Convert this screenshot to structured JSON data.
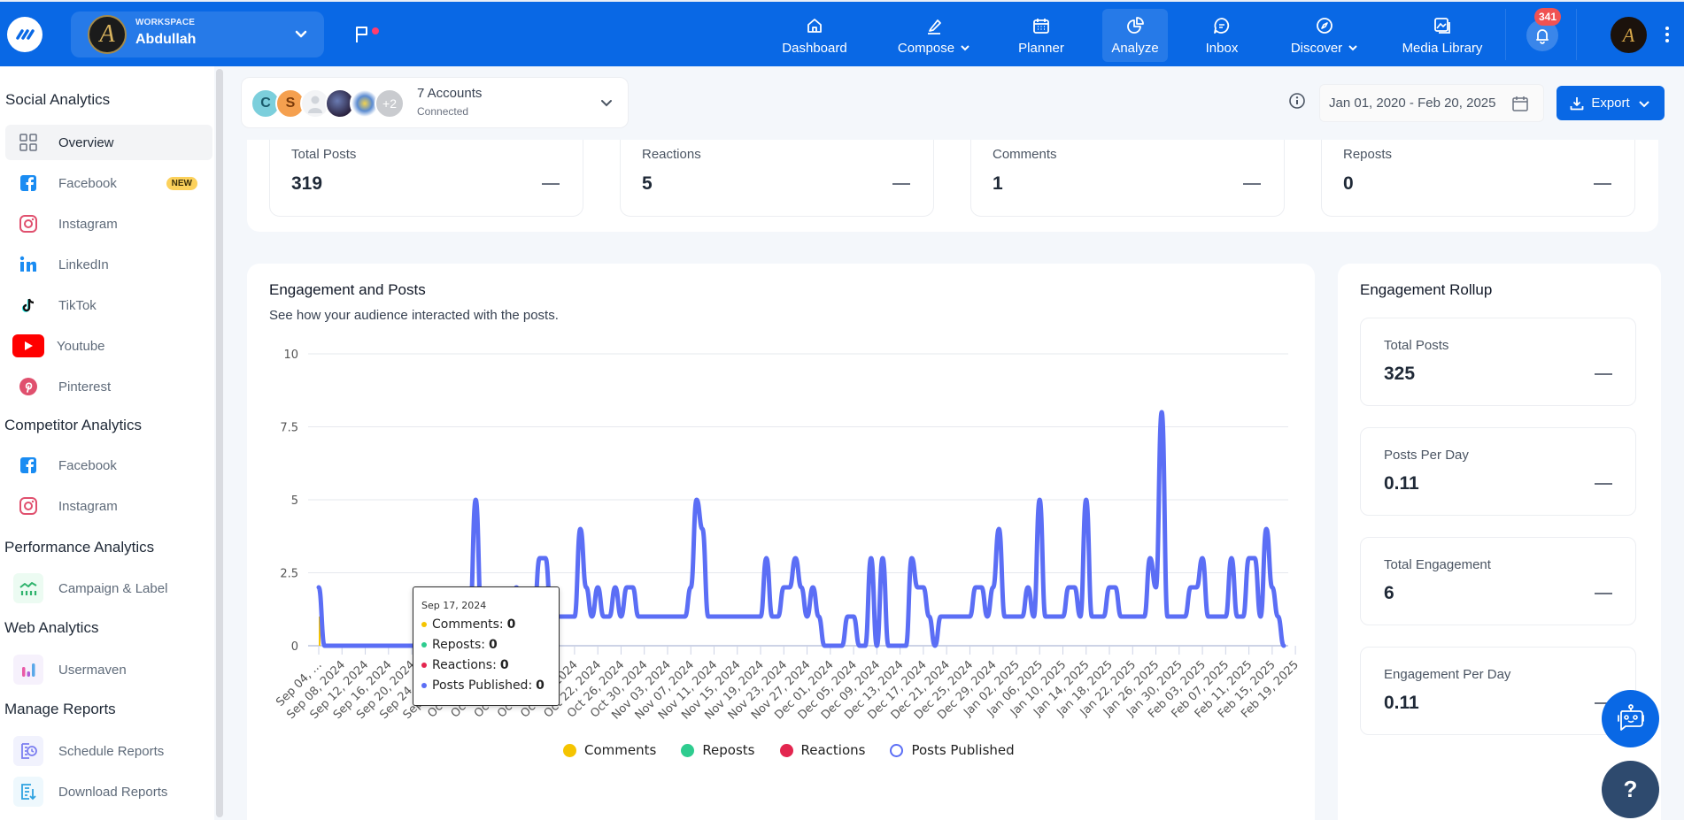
{
  "topbar": {
    "workspace_label": "WORKSPACE",
    "workspace_name": "Abdullah",
    "workspace_initial": "A",
    "nav": [
      {
        "label": "Dashboard",
        "icon": "home-icon",
        "has_dropdown": false,
        "active": false
      },
      {
        "label": "Compose",
        "icon": "pen-icon",
        "has_dropdown": true,
        "active": false
      },
      {
        "label": "Planner",
        "icon": "calendar-icon",
        "has_dropdown": false,
        "active": false
      },
      {
        "label": "Analyze",
        "icon": "pie-chart-icon",
        "has_dropdown": false,
        "active": true
      },
      {
        "label": "Inbox",
        "icon": "chat-icon",
        "has_dropdown": false,
        "active": false
      },
      {
        "label": "Discover",
        "icon": "compass-icon",
        "has_dropdown": true,
        "active": false
      },
      {
        "label": "Media Library",
        "icon": "image-gallery-icon",
        "has_dropdown": false,
        "active": false
      }
    ],
    "notification_count": "341",
    "user_initial": "A"
  },
  "sidebar": {
    "sections": [
      {
        "title": "Social Analytics",
        "items": [
          {
            "label": "Overview",
            "icon": "grid-icon",
            "active": true
          },
          {
            "label": "Facebook",
            "icon": "facebook-icon",
            "badge": "NEW"
          },
          {
            "label": "Instagram",
            "icon": "instagram-icon"
          },
          {
            "label": "LinkedIn",
            "icon": "linkedin-icon"
          },
          {
            "label": "TikTok",
            "icon": "tiktok-icon"
          },
          {
            "label": "Youtube",
            "icon": "youtube-icon"
          },
          {
            "label": "Pinterest",
            "icon": "pinterest-icon"
          }
        ]
      },
      {
        "title": "Competitor Analytics",
        "items": [
          {
            "label": "Facebook",
            "icon": "facebook-icon"
          },
          {
            "label": "Instagram",
            "icon": "instagram-icon"
          }
        ]
      },
      {
        "title": "Performance Analytics",
        "items": [
          {
            "label": "Campaign & Label",
            "icon": "campaign-chart-icon"
          }
        ]
      },
      {
        "title": "Web Analytics",
        "items": [
          {
            "label": "Usermaven",
            "icon": "usermaven-icon"
          }
        ]
      },
      {
        "title": "Manage Reports",
        "items": [
          {
            "label": "Schedule Reports",
            "icon": "schedule-report-icon"
          },
          {
            "label": "Download Reports",
            "icon": "download-report-icon"
          }
        ]
      }
    ]
  },
  "accounts": {
    "title": "7 Accounts",
    "subtitle": "Connected",
    "avatars": [
      "C",
      "S",
      "",
      "",
      "",
      "+2"
    ]
  },
  "date_range": "Jan 01, 2020 - Feb 20, 2025",
  "export_label": "Export",
  "summary": [
    {
      "label": "Total Posts",
      "value": "319"
    },
    {
      "label": "Reactions",
      "value": "5"
    },
    {
      "label": "Comments",
      "value": "1"
    },
    {
      "label": "Reposts",
      "value": "0"
    }
  ],
  "engagement_chart": {
    "title": "Engagement and Posts",
    "subtitle": "See how your audience interacted with the posts."
  },
  "tooltip": {
    "date": "Sep 17, 2024",
    "rows": [
      {
        "label": "Comments:",
        "value": "0",
        "color": "#f5c400"
      },
      {
        "label": "Reposts:",
        "value": "0",
        "color": "#2ecc8f"
      },
      {
        "label": "Reactions:",
        "value": "0",
        "color": "#e3264f"
      },
      {
        "label": "Posts Published:",
        "value": "0",
        "color": "#5b6ef5"
      }
    ]
  },
  "rollup": {
    "title": "Engagement Rollup",
    "cards": [
      {
        "label": "Total Posts",
        "value": "325"
      },
      {
        "label": "Posts Per Day",
        "value": "0.11"
      },
      {
        "label": "Total Engagement",
        "value": "6"
      },
      {
        "label": "Engagement Per Day",
        "value": "0.11"
      }
    ]
  },
  "help_label": "?",
  "chart_data": {
    "type": "line",
    "title": "Engagement and Posts",
    "subtitle": "See how your audience interacted with the posts.",
    "xlabel": "",
    "ylabel": "",
    "ylim": [
      0,
      10
    ],
    "yticks": [
      "0",
      "2.5",
      "5",
      "7.5",
      "10"
    ],
    "start_date": "2024-09-04",
    "x_tick_every_days": 4,
    "x_tick_labels": [
      "Sep 04, …",
      "Sep 08, 2024",
      "Sep 12, 2024",
      "Sep 16, 2024",
      "Sep 20, 2024",
      "Sep 24, 2024",
      "Sep 28, 2024",
      "Oct 02, 2024",
      "Oct 06, 2024",
      "Oct 10, 2024",
      "Oct 14, 2024",
      "Oct 18, 2024",
      "Oct 22, 2024",
      "Oct 26, 2024",
      "Oct 30, 2024",
      "Nov 03, 2024",
      "Nov 07, 2024",
      "Nov 11, 2024",
      "Nov 15, 2024",
      "Nov 19, 2024",
      "Nov 23, 2024",
      "Nov 27, 2024",
      "Dec 01, 2024",
      "Dec 05, 2024",
      "Dec 09, 2024",
      "Dec 13, 2024",
      "Dec 17, 2024",
      "Dec 21, 2024",
      "Dec 25, 2024",
      "Dec 29, 2024",
      "Jan 02, 2025",
      "Jan 06, 2025",
      "Jan 10, 2025",
      "Jan 14, 2025",
      "Jan 18, 2025",
      "Jan 22, 2025",
      "Jan 26, 2025",
      "Jan 30, 2025",
      "Feb 03, 2025",
      "Feb 07, 2025",
      "Feb 11, 2025",
      "Feb 15, 2025",
      "Feb 19, 2025"
    ],
    "legend": [
      "Comments",
      "Reposts",
      "Reactions",
      "Posts Published"
    ],
    "legend_position": "bottom",
    "grid": true,
    "series": [
      {
        "name": "Comments",
        "color": "#f5c400",
        "values_by_day": {
          "0": 1
        }
      },
      {
        "name": "Reposts",
        "color": "#2ecc8f",
        "values_by_day": {}
      },
      {
        "name": "Reactions",
        "color": "#e3264f",
        "values_by_day": {}
      },
      {
        "name": "Posts Published",
        "color": "#5b6ef5",
        "values": [
          2,
          0,
          0,
          0,
          0,
          0,
          0,
          0,
          0,
          0,
          0,
          0,
          0,
          0,
          0,
          0,
          0,
          0,
          0,
          0,
          0,
          0,
          0,
          0,
          0,
          1,
          1,
          5,
          1,
          1,
          1,
          1,
          1,
          1,
          2,
          1,
          1,
          1,
          3,
          3,
          1,
          1,
          1,
          1,
          1,
          4,
          2,
          1,
          2,
          1,
          1,
          2,
          1,
          2,
          2,
          1,
          1,
          1,
          1,
          1,
          1,
          1,
          1,
          1,
          2,
          5,
          4,
          1,
          1,
          1,
          1,
          1,
          1,
          1,
          1,
          1,
          1,
          3,
          1,
          1,
          2,
          2,
          3,
          2,
          1,
          2,
          1,
          0,
          0,
          0,
          0,
          1,
          1,
          0,
          0,
          3,
          0,
          3,
          0,
          0,
          0,
          0,
          3,
          2,
          2,
          1,
          0,
          1,
          1,
          1,
          1,
          1,
          1,
          2,
          2,
          1,
          2,
          4,
          1,
          1,
          1,
          1,
          2,
          1,
          5,
          1,
          1,
          1,
          1,
          2,
          2,
          1,
          5,
          1,
          1,
          1,
          2,
          2,
          1,
          1,
          1,
          1,
          1,
          3,
          2,
          8,
          1,
          1,
          1,
          1,
          2,
          2,
          3,
          1,
          1,
          1,
          1,
          3,
          1,
          1,
          3,
          3,
          1,
          4,
          2,
          1,
          0
        ]
      }
    ]
  }
}
